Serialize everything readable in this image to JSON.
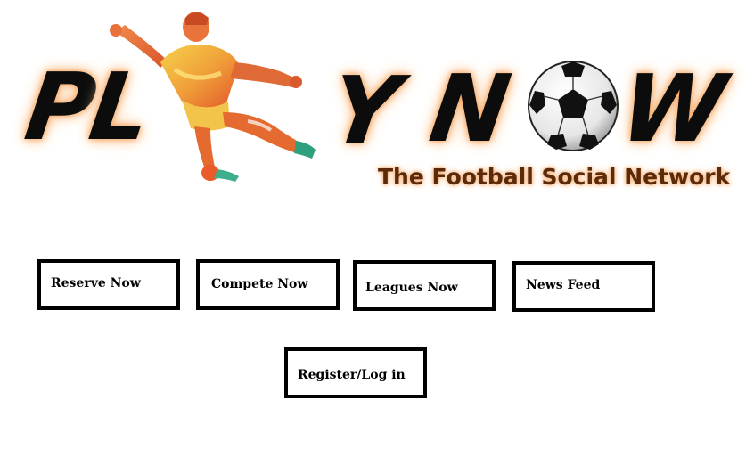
{
  "logo": {
    "letters": {
      "p": "P",
      "l": "L",
      "y": "Y",
      "n": "N",
      "w": "W"
    },
    "tagline": "The Football Social Network",
    "brand_glow_color": "#f7a15a",
    "player_icon": "football-player-kicking",
    "ball_icon": "soccer-ball"
  },
  "nav": {
    "reserve": "Reserve Now",
    "compete": "Compete Now",
    "leagues": "Leagues Now",
    "news": "News Feed",
    "register": "Register/Log in"
  }
}
